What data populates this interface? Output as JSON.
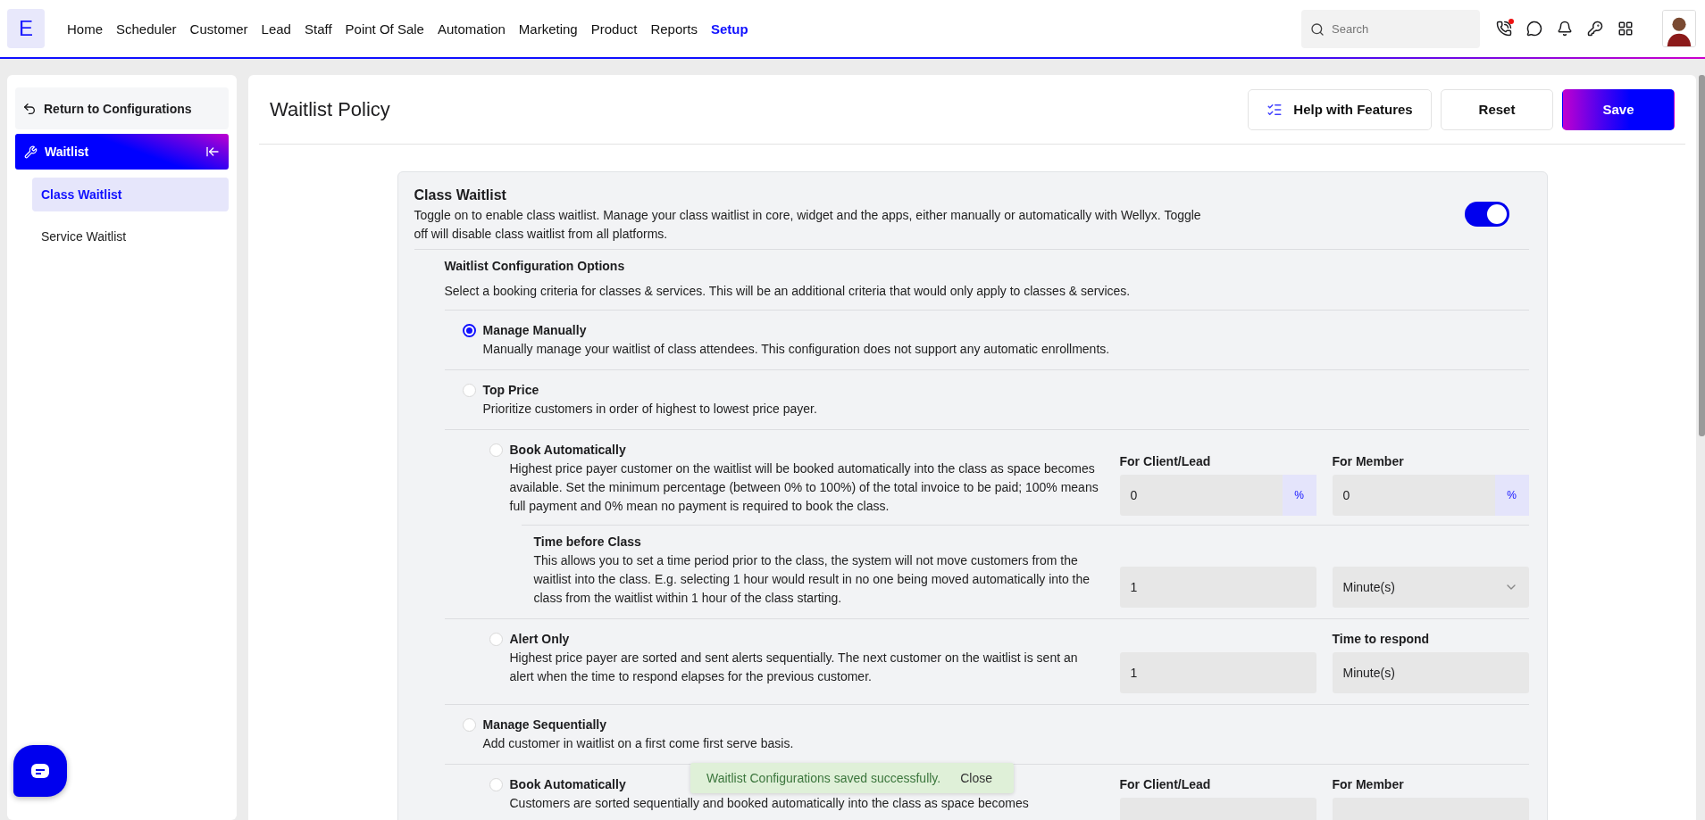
{
  "nav": {
    "logo": "E",
    "items": [
      {
        "label": "Home",
        "selected": false
      },
      {
        "label": "Scheduler",
        "selected": false
      },
      {
        "label": "Customer",
        "selected": false
      },
      {
        "label": "Lead",
        "selected": false
      },
      {
        "label": "Staff",
        "selected": false
      },
      {
        "label": "Point Of Sale",
        "selected": false
      },
      {
        "label": "Automation",
        "selected": false
      },
      {
        "label": "Marketing",
        "selected": false
      },
      {
        "label": "Product",
        "selected": false
      },
      {
        "label": "Reports",
        "selected": false
      },
      {
        "label": "Setup",
        "selected": true
      }
    ],
    "search": {
      "placeholder": "Search"
    },
    "phone_alert": true
  },
  "sidebar": {
    "back": "Return to Configurations",
    "section": "Waitlist",
    "items": [
      {
        "label": "Class Waitlist",
        "selected": true
      },
      {
        "label": "Service Waitlist",
        "selected": false
      }
    ]
  },
  "header": {
    "title": "Waitlist Policy",
    "buttons": [
      {
        "label": "Help with Features",
        "kind": "help"
      },
      {
        "label": "Reset",
        "kind": "plain"
      },
      {
        "label": "Save",
        "kind": "primary"
      }
    ]
  },
  "class_waitlist": {
    "title": "Class Waitlist",
    "description": "Toggle on to enable class waitlist. Manage your class waitlist in core, widget and the apps, either manually or automatically with Wellyx. Toggle off will disable class waitlist from all platforms.",
    "on": true
  },
  "configuration": {
    "title": "Waitlist Configuration Options",
    "description": "Select a booking criteria for classes & services. This will be an additional criteria that would only apply to classes & services.",
    "options": [
      {
        "label": "Manage Manually",
        "description": "Manually manage your waitlist of class attendees. This configuration does not support any automatic enrollments.",
        "selected": true
      },
      {
        "label": "Top Price",
        "description": "Prioritize customers in order of highest to lowest price payer.",
        "selected": false,
        "sub_options": [
          {
            "label": "Book Automatically",
            "description": "Highest price payer customer on the waitlist will be booked automatically into the class as space becomes available. Set the minimum percentage (between 0% to 100%) of the total invoice to be paid; 100% means full payment and 0% mean no payment is required to book the class.",
            "selected": false,
            "fields": [
              {
                "kind": "percent",
                "label": "For Client/Lead",
                "value": "0",
                "unit": "%"
              },
              {
                "kind": "percent",
                "label": "For Member",
                "value": "0",
                "unit": "%"
              }
            ],
            "detail": {
              "title": "Time before Class",
              "description": "This allows you to set a time period prior to the class, the system will not move customers from the waitlist into the class. E.g. selecting 1 hour would result in no one being moved automatically into the class from the waitlist within 1 hour of the class starting.",
              "fields": [
                {
                  "kind": "text",
                  "value": "1"
                },
                {
                  "kind": "select",
                  "value": "Minute(s)"
                }
              ]
            }
          },
          {
            "label": "Alert Only",
            "description": "Highest price payer are sorted and sent alerts sequentially. The next customer on the waitlist is sent an alert when the time to respond elapses for the previous customer.",
            "selected": false,
            "fields": [
              {
                "kind": "text",
                "value": "1"
              },
              {
                "kind": "text",
                "label": "Time to respond",
                "value": "Minute(s)"
              }
            ]
          }
        ]
      },
      {
        "label": "Manage Sequentially",
        "description": "Add customer in waitlist on a first come first serve basis.",
        "selected": false,
        "sub_options": [
          {
            "label": "Book Automatically",
            "description": "Customers are sorted sequentially and booked automatically into the class as space becomes",
            "selected": false,
            "fields": [
              {
                "kind": "percent",
                "label": "For Client/Lead"
              },
              {
                "kind": "percent",
                "label": "For Member"
              }
            ]
          }
        ]
      }
    ]
  },
  "toast": {
    "message": "Waitlist Configurations saved successfully.",
    "action": "Close"
  }
}
